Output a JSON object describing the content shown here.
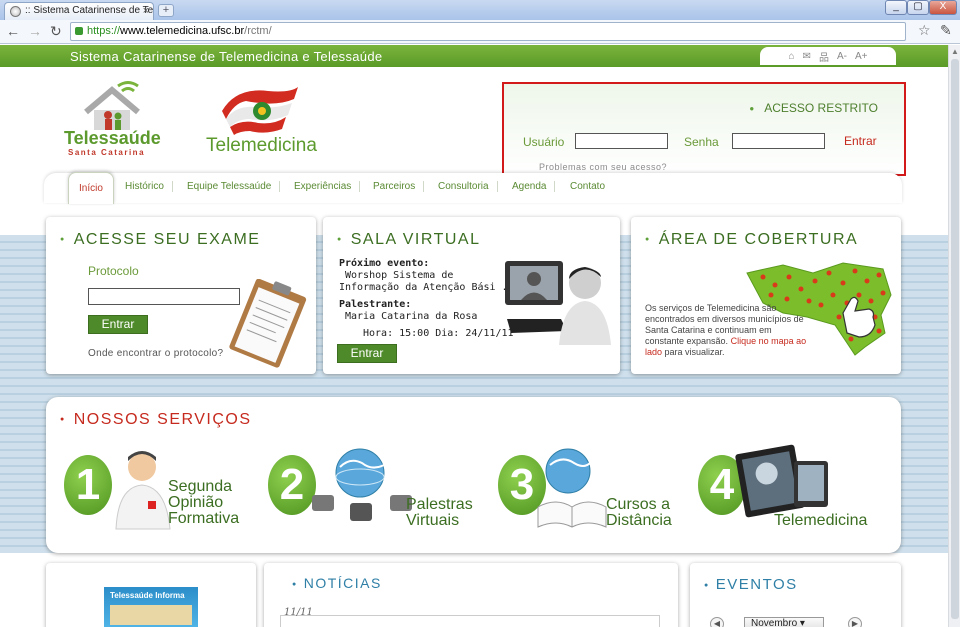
{
  "browser": {
    "tab_title": ":: Sistema Catarinense de Tele",
    "tab_close": "×",
    "new_tab": "+",
    "url_scheme": "https://",
    "url_host": "www.telemedicina.ufsc.br",
    "url_path": "/rctm/",
    "window_buttons": [
      "_",
      "▢",
      "X"
    ]
  },
  "site": {
    "title": "Sistema Catarinense de Telemedicina e Telessaúde",
    "tools": [
      "⌂",
      "✉",
      "品",
      "A-",
      "A+"
    ]
  },
  "logos": {
    "telessaude": "Telessaúde",
    "telessaude_sub": "Santa Catarina",
    "telemedicina": "Telemedicina"
  },
  "login": {
    "title": "ACESSO RESTRITO",
    "user_label": "Usuário",
    "password_label": "Senha",
    "user_value": "",
    "password_value": "",
    "enter": "Entrar",
    "help": "Problemas com seu acesso?"
  },
  "nav": {
    "items": [
      "Início",
      "Histórico",
      "Equipe Telessaúde",
      "Experiências",
      "Parceiros",
      "Consultoria",
      "Agenda",
      "Contato"
    ]
  },
  "exam": {
    "title": "ACESSE SEU EXAME",
    "protocol_label": "Protocolo",
    "protocol_value": "",
    "enter": "Entrar",
    "help": "Onde encontrar o protocolo?"
  },
  "virtual_room": {
    "title": "SALA VIRTUAL",
    "next_event_label": "Próximo evento:",
    "next_event_line1": "Worshop Sistema de",
    "next_event_line2": "Informação da Atenção Bási ...",
    "speaker_label": "Palestrante:",
    "speaker": "Maria Catarina da Rosa",
    "time": "Hora: 15:00 Dia: 24/11/11",
    "enter": "Entrar"
  },
  "coverage": {
    "title": "ÁREA DE COBERTURA",
    "text": "Os serviços de Telemedicina são encontrados em diversos municípios de Santa Catarina e continuam em constante expansão.",
    "link": "Clique no mapa ao lado",
    "link_suffix": " para visualizar."
  },
  "services": {
    "title": "NOSSOS SERVIÇOS",
    "items": [
      {
        "num": "1",
        "label1": "Segunda",
        "label2": "Opinião",
        "label3": "Formativa"
      },
      {
        "num": "2",
        "label1": "Palestras",
        "label2": "Virtuais",
        "label3": ""
      },
      {
        "num": "3",
        "label1": "Cursos a",
        "label2": "Distância",
        "label3": ""
      },
      {
        "num": "4",
        "label1": "Telemedicina",
        "label2": "",
        "label3": ""
      }
    ]
  },
  "bottom": {
    "magazine": "Telessaúde Informa",
    "news_title": "NOTÍCIAS",
    "news_date": "11/11",
    "events_title": "EVENTOS",
    "events_month": "Novembro",
    "prev": "◀",
    "next": "▶"
  },
  "colors": {
    "brand_green": "#5c9a2e",
    "accent_red": "#c62a1e",
    "login_border": "#d31a1a",
    "news_blue": "#2f7fa6"
  }
}
